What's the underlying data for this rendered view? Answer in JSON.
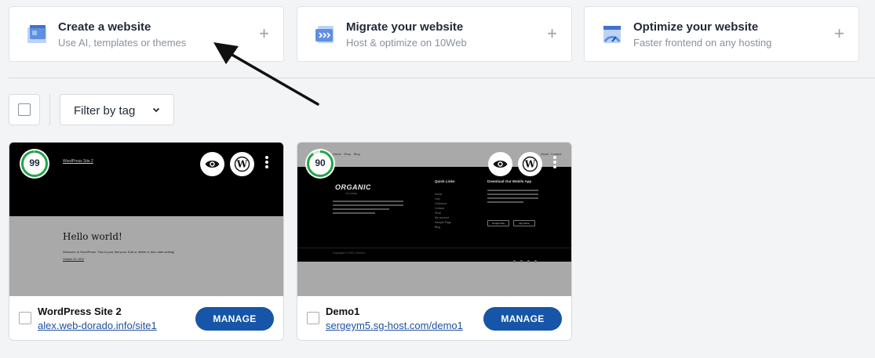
{
  "actions": [
    {
      "title": "Create a website",
      "subtitle": "Use AI, templates or themes",
      "icon": "create-website-icon"
    },
    {
      "title": "Migrate your website",
      "subtitle": "Host & optimize on 10Web",
      "icon": "migrate-website-icon"
    },
    {
      "title": "Optimize your website",
      "subtitle": "Faster frontend on any hosting",
      "icon": "optimize-website-icon"
    }
  ],
  "plus_symbol": "+",
  "filter": {
    "label": "Filter by tag"
  },
  "colors": {
    "accent": "#1655a8",
    "score_green": "#22a447",
    "link": "#1f4fa0"
  },
  "sites": [
    {
      "name": "WordPress Site 2",
      "url": "alex.web-dorado.info/site1",
      "score": "99",
      "score_percent": 99,
      "manage_label": "MANAGE",
      "preview": {
        "site_title": "WordPress Site 2",
        "heading": "Hello world!",
        "body": "Welcome to WordPress. This is your first post. Edit or delete it, then start writing!",
        "date": "October 20, 2022"
      }
    },
    {
      "name": "Demo1",
      "url": "sergeym5.sg-host.com/demo1",
      "score": "90",
      "score_percent": 90,
      "manage_label": "MANAGE",
      "preview": {
        "logo": "ORGANIC",
        "logo_sub": "STORE",
        "nav": [
          "Home",
          "Shop",
          "Blog",
          "About",
          "Contact"
        ],
        "col1_title": "Quick Links",
        "col1_items": [
          "Home",
          "Cart",
          "Checkout",
          "Contact",
          "Shop",
          "My account",
          "Sample Page",
          "Blog"
        ],
        "col2_title": "Download Our Mobile App",
        "badges": [
          "Google Play",
          "App Store"
        ],
        "copyright": "Copyright © 2022 | Demo1"
      }
    }
  ]
}
